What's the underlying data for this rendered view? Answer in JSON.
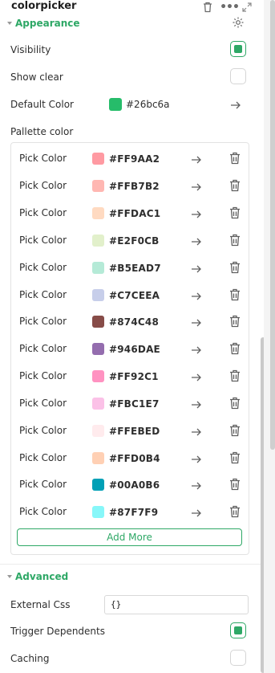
{
  "header": {
    "title": "colorpicker",
    "icons": [
      "trash-icon",
      "more-icon",
      "expand-icon"
    ]
  },
  "appearance": {
    "label": "Appearance",
    "visibility": {
      "label": "Visibility",
      "checked": true
    },
    "show_clear": {
      "label": "Show clear",
      "checked": false
    },
    "default_color": {
      "label": "Default Color",
      "value": "#26bc6a",
      "color": "#26bc6a"
    },
    "palette_label": "Pallette color",
    "palette": [
      {
        "label": "Pick Color",
        "hex": "#FF9AA2",
        "color": "#FF9AA2"
      },
      {
        "label": "Pick Color",
        "hex": "#FFB7B2",
        "color": "#FFB7B2"
      },
      {
        "label": "Pick Color",
        "hex": "#FFDAC1",
        "color": "#FFDAC1"
      },
      {
        "label": "Pick Color",
        "hex": "#E2F0CB",
        "color": "#E2F0CB"
      },
      {
        "label": "Pick Color",
        "hex": "#B5EAD7",
        "color": "#B5EAD7"
      },
      {
        "label": "Pick Color",
        "hex": "#C7CEEA",
        "color": "#C7CEEA"
      },
      {
        "label": "Pick Color",
        "hex": "#874C48",
        "color": "#874C48"
      },
      {
        "label": "Pick Color",
        "hex": "#946DAE",
        "color": "#946DAE"
      },
      {
        "label": "Pick Color",
        "hex": "#FF92C1",
        "color": "#FF92C1"
      },
      {
        "label": "Pick Color",
        "hex": "#FBC1E7",
        "color": "#FBC1E7"
      },
      {
        "label": "Pick Color",
        "hex": "#FFEBED",
        "color": "#FFEBED"
      },
      {
        "label": "Pick Color",
        "hex": "#FFD0B4",
        "color": "#FFD0B4"
      },
      {
        "label": "Pick Color",
        "hex": "#00A0B6",
        "color": "#00A0B6"
      },
      {
        "label": "Pick Color",
        "hex": "#87F7F9",
        "color": "#87F7F9"
      }
    ],
    "add_more_label": "Add More"
  },
  "advanced": {
    "label": "Advanced",
    "external_css": {
      "label": "External Css",
      "value": "{}"
    },
    "trigger_dependents": {
      "label": "Trigger Dependents",
      "checked": true
    },
    "caching": {
      "label": "Caching",
      "checked": false
    }
  },
  "colors": {
    "accent": "#2ea866",
    "border": "#e3e3e3"
  }
}
